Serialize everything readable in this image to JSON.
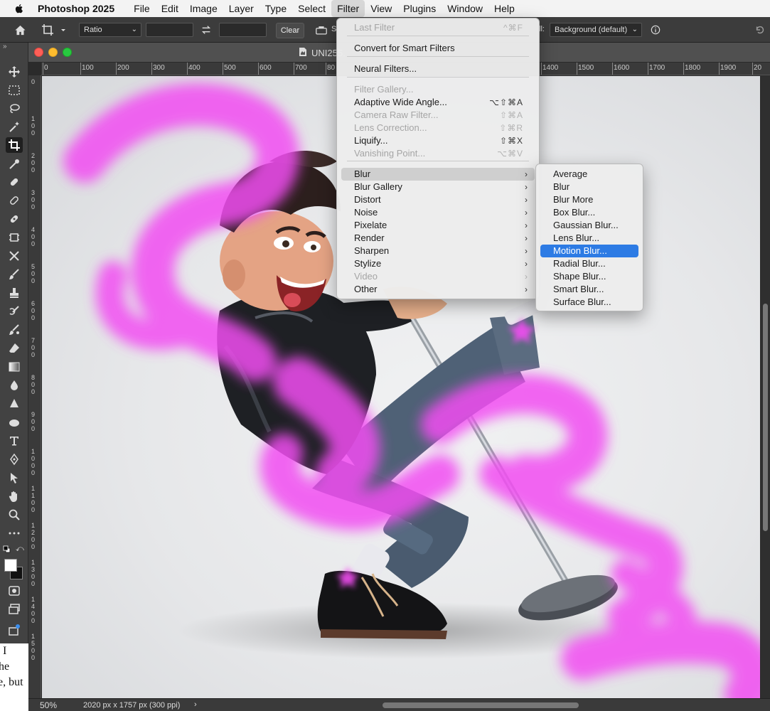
{
  "menubar": {
    "app_name": "Photoshop 2025",
    "items": [
      "File",
      "Edit",
      "Image",
      "Layer",
      "Type",
      "Select",
      "Filter",
      "View",
      "Plugins",
      "Window",
      "Help"
    ]
  },
  "options_bar": {
    "ratio_label": "Ratio",
    "clear_label": "Clear",
    "straighten_partial": "S",
    "fill_label_partial": "ll:",
    "fill_value": "Background (default)"
  },
  "document": {
    "title": "UNI255.",
    "zoom": "50%",
    "doc_info": "2020 px x 1757 px (300 ppi)",
    "ruler_labels": [
      "0",
      "100",
      "200",
      "300",
      "400",
      "500",
      "600",
      "700",
      "80",
      "1400",
      "1500",
      "1600",
      "1700",
      "1800",
      "1900",
      "20"
    ],
    "left_ruler_labels": [
      "0",
      "100",
      "200",
      "300",
      "400",
      "500",
      "600",
      "700",
      "800",
      "900",
      "1000",
      "1100",
      "1200",
      "1300",
      "1400",
      "1500"
    ]
  },
  "filter_menu": {
    "items": [
      {
        "label": "Last Filter",
        "shortcut": "^⌘F",
        "disabled": true
      },
      {
        "label": "Convert for Smart Filters",
        "shortcut": "",
        "disabled": false
      },
      {
        "label": "Neural Filters...",
        "shortcut": "",
        "disabled": false
      },
      {
        "label": "Filter Gallery...",
        "shortcut": "",
        "disabled": true
      },
      {
        "label": "Adaptive Wide Angle...",
        "shortcut": "⌥⇧⌘A",
        "disabled": false
      },
      {
        "label": "Camera Raw Filter...",
        "shortcut": "⇧⌘A",
        "disabled": true
      },
      {
        "label": "Lens Correction...",
        "shortcut": "⇧⌘R",
        "disabled": true
      },
      {
        "label": "Liquify...",
        "shortcut": "⇧⌘X",
        "disabled": false
      },
      {
        "label": "Vanishing Point...",
        "shortcut": "⌥⌘V",
        "disabled": true
      },
      {
        "label": "Blur",
        "submenu": true,
        "disabled": false
      },
      {
        "label": "Blur Gallery",
        "submenu": true,
        "disabled": false
      },
      {
        "label": "Distort",
        "submenu": true,
        "disabled": false
      },
      {
        "label": "Noise",
        "submenu": true,
        "disabled": false
      },
      {
        "label": "Pixelate",
        "submenu": true,
        "disabled": false
      },
      {
        "label": "Render",
        "submenu": true,
        "disabled": false
      },
      {
        "label": "Sharpen",
        "submenu": true,
        "disabled": false
      },
      {
        "label": "Stylize",
        "submenu": true,
        "disabled": false
      },
      {
        "label": "Video",
        "submenu": true,
        "disabled": true
      },
      {
        "label": "Other",
        "submenu": true,
        "disabled": false
      }
    ]
  },
  "blur_submenu": {
    "items": [
      "Average",
      "Blur",
      "Blur More",
      "Box Blur...",
      "Gaussian Blur...",
      "Lens Blur...",
      "Motion Blur...",
      "Radial Blur...",
      "Shape Blur...",
      "Smart Blur...",
      "Surface Blur..."
    ],
    "highlighted": "Motion Blur..."
  },
  "background_doc_text": [
    "I",
    "he",
    "e, but"
  ],
  "colors": {
    "accent": "#2d7be4",
    "ui_dark": "#3c3c3c",
    "paint_magenta": "#f24df2"
  }
}
